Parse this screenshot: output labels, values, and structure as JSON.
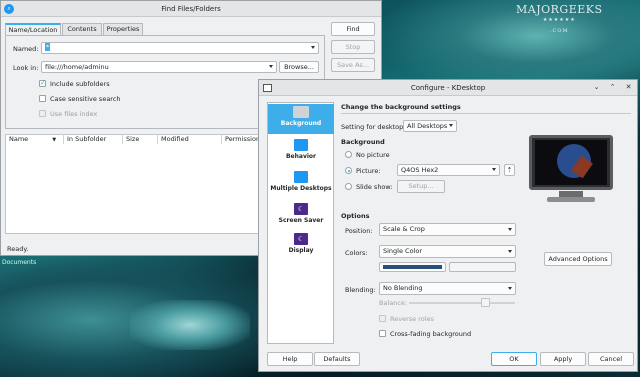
{
  "desktop": {
    "text": "Documents"
  },
  "watermark": {
    "line1": "MAJORGEEKS",
    "line2": ".COM",
    "stars": "★★★★★★"
  },
  "find": {
    "title": "Find Files/Folders",
    "tabs": [
      "Name/Location",
      "Contents",
      "Properties"
    ],
    "named_label": "Named:",
    "named_value": "*",
    "lookin_label": "Look in:",
    "lookin_value": "file:///home/adminu",
    "browse": "Browse...",
    "include_subfolders": "Include subfolders",
    "case_sensitive": "Case sensitive search",
    "use_files_index": "Use files index",
    "buttons": {
      "find": "Find",
      "stop": "Stop",
      "save_as": "Save As..."
    },
    "columns": [
      "Name",
      "In Subfolder",
      "Size",
      "Modified",
      "Permission"
    ],
    "status": "Ready."
  },
  "kdesktop": {
    "title": "Configure - KDesktop",
    "sidebar": [
      "Background",
      "Behavior",
      "Multiple Desktops",
      "Screen Saver",
      "Display"
    ],
    "header": "Change the background settings",
    "setting_for_label": "Setting for desktop:",
    "setting_for_value": "All Desktops",
    "background_section": "Background",
    "no_picture": "No picture",
    "picture": "Picture:",
    "picture_value": "Q4OS Hex2",
    "slide_show": "Slide show:",
    "setup": "Setup...",
    "options_section": "Options",
    "position_label": "Position:",
    "position_value": "Scale & Crop",
    "colors_label": "Colors:",
    "colors_value": "Single Color",
    "color_primary": "#2b4f7d",
    "advanced": "Advanced Options",
    "blending_label": "Blending:",
    "blending_value": "No Blending",
    "balance": "Balance:",
    "reverse_roles": "Reverse roles",
    "cross_fading": "Cross-fading background",
    "buttons": {
      "help": "Help",
      "defaults": "Defaults",
      "ok": "OK",
      "apply": "Apply",
      "cancel": "Cancel"
    }
  }
}
